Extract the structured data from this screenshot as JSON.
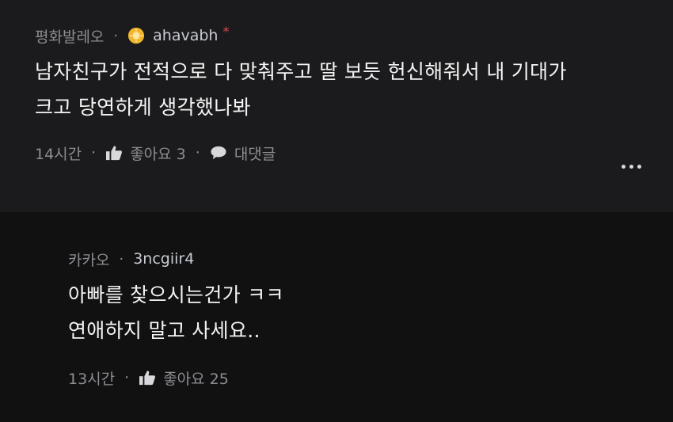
{
  "comments": [
    {
      "source": "평화발레오",
      "username": "ahavabh",
      "mark": "*",
      "lines": [
        "남자친구가 전적으로 다 맞춰주고 딸 보듯 헌신해줘서 내 기대가",
        "크고 당연하게 생각했나봐"
      ],
      "time": "14시간",
      "likes_label": "좋아요 3",
      "reply_label": "대댓글",
      "badge_icon": "sun-badge-icon",
      "badge_color": "#f2b62d"
    },
    {
      "source": "카카오",
      "username": "3ncgiir4",
      "lines": [
        "아빠를 찾으시는건가 ㅋㅋ",
        "연애하지 말고 사세요.."
      ],
      "time": "13시간",
      "likes_label": "좋아요 25"
    }
  ],
  "colors": {
    "bg_top": "#1b1b1d",
    "bg_reply": "#111112",
    "meta": "#8d8d92",
    "text": "#f4f4f4"
  },
  "icons": {
    "like": "thumbs-up-icon",
    "reply": "speech-bubble-icon",
    "more": "more-dots-icon"
  }
}
